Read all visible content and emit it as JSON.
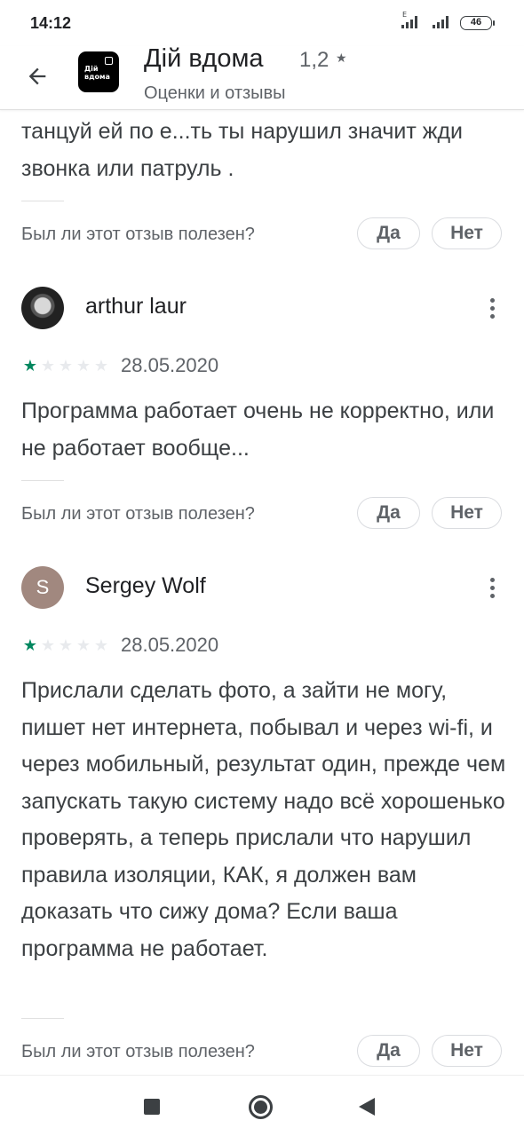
{
  "status_bar": {
    "time": "14:12",
    "network_type": "E",
    "battery": "46"
  },
  "app_bar": {
    "back_icon": "arrow-left-icon",
    "app_icon_text": "Дій вдома",
    "title": "Дій вдома",
    "rating": "1,2",
    "rating_star": "★",
    "subtitle": "Оценки и отзывы"
  },
  "colors": {
    "star_filled": "#01875f",
    "star_empty": "#e8eaed",
    "text_primary": "#202124",
    "text_secondary": "#5f6368",
    "avatar_letter_bg": "#a1887f"
  },
  "reviews": [
    {
      "text": "танцуй ей по е...ть ты нарушил значит жди звонка или патруль .",
      "helpful_question": "Был ли этот отзыв полезен?",
      "yes_label": "Да",
      "no_label": "Нет"
    },
    {
      "author": "arthur laur",
      "avatar": "photo",
      "rating": 1,
      "rating_max": 5,
      "date": "28.05.2020",
      "text": "Программа работает очень не корректно, или не работает вообще...",
      "helpful_question": "Был ли этот отзыв полезен?",
      "yes_label": "Да",
      "no_label": "Нет"
    },
    {
      "author": "Sergey Wolf",
      "avatar_letter": "S",
      "rating": 1,
      "rating_max": 5,
      "date": "28.05.2020",
      "text": "Прислали сделать фото, а зайти не могу, пишет нет интернета, побывал и через wi-fi, и через мобильный, результат один, прежде чем запускать такую систему надо всё хорошенько проверять, а теперь прислали что нарушил правила изоляции, КАК, я должен вам доказать что сижу дома? Если ваша программа не работает.",
      "helpful_question": "Был ли этот отзыв полезен?",
      "yes_label": "Да",
      "no_label": "Нет"
    }
  ],
  "nav_bar": {
    "recents_icon": "square-icon",
    "home_icon": "circle-home-icon",
    "back_icon": "triangle-back-icon"
  },
  "star_glyph": "★"
}
